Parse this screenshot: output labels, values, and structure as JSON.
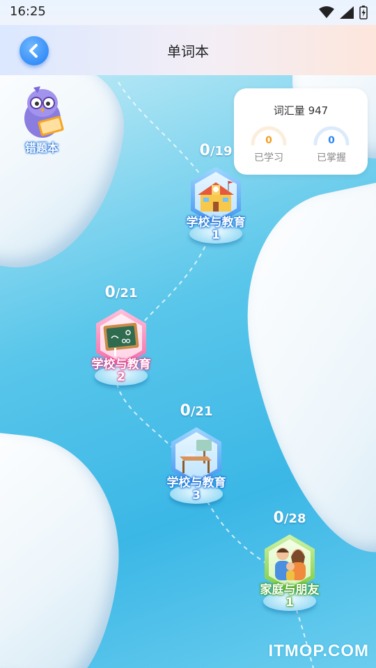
{
  "status_bar": {
    "time": "16:25",
    "icons": [
      "wifi-icon",
      "signal-icon",
      "battery-icon"
    ]
  },
  "header": {
    "title": "单词本",
    "back_icon": "back-arrow-icon"
  },
  "stats": {
    "vocab_label": "词汇量 947",
    "learned_value": "0",
    "learned_label": "已学习",
    "mastered_value": "0",
    "mastered_label": "已掌握",
    "learned_color": "#f0a020",
    "mastered_color": "#2c86f5"
  },
  "error_book": {
    "label": "错题本",
    "icon": "bird-reading-icon"
  },
  "lessons": [
    {
      "progress_done": "0",
      "progress_total": "/19",
      "name": "学校与教育",
      "number": "1",
      "theme": "blue",
      "icon": "school-building-icon"
    },
    {
      "progress_done": "0",
      "progress_total": "/21",
      "name": "学校与教育",
      "number": "2",
      "theme": "pink",
      "icon": "chalkboard-icon"
    },
    {
      "progress_done": "0",
      "progress_total": "/21",
      "name": "学校与教育",
      "number": "3",
      "theme": "blue",
      "icon": "desk-chair-icon"
    },
    {
      "progress_done": "0",
      "progress_total": "/28",
      "name": "家庭与朋友",
      "number": "1",
      "theme": "green",
      "icon": "family-icon"
    }
  ],
  "watermark": "ITMOP.COM"
}
